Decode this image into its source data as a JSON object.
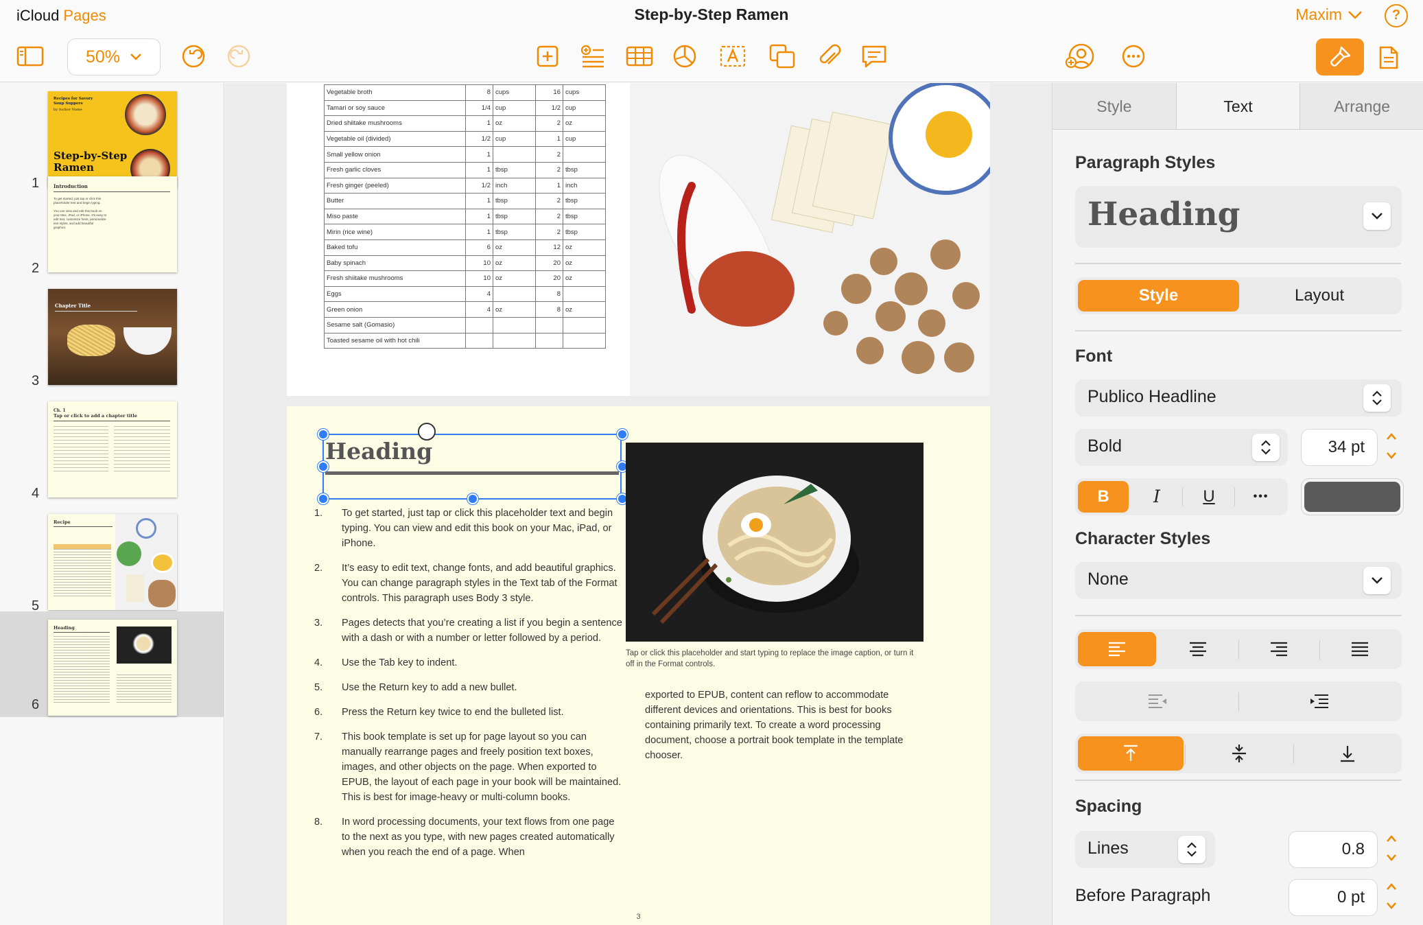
{
  "app": {
    "brand_a": "iCloud",
    "brand_b": "Pages"
  },
  "document": {
    "title": "Step-by-Step Ramen"
  },
  "user": {
    "name": "Maxim"
  },
  "toolbar": {
    "zoom": "50%",
    "icons": [
      "sidebar-icon",
      "undo-icon",
      "redo-icon",
      "add-page-icon",
      "insert-text-icon",
      "table-icon",
      "chart-icon",
      "text-box-icon",
      "shape-icon",
      "attachment-icon",
      "comment-icon",
      "collaborate-icon",
      "more-icon",
      "format-brush-icon",
      "document-icon"
    ],
    "accent": "#f7921e"
  },
  "sidebar": {
    "pages": [
      {
        "num": "1",
        "t1": "Recipes for Savory Soup Suppers",
        "t2": "by Author Name",
        "t3": "Step-by-Step Ramen"
      },
      {
        "num": "2",
        "t1": "Introduction",
        "t2": "To get started, just tap or click this placeholder text and begin typing.",
        "t3": "You can view and edit this book on your Mac, iPad, or iPhone. It's easy to edit text, customize fonts, personalize text styles, and add beautiful graphics."
      },
      {
        "num": "3",
        "t1": "Chapter Title"
      },
      {
        "num": "4",
        "t1": "Ch. 1",
        "t2": "Tap or click to add a chapter title"
      },
      {
        "num": "5",
        "t1": "Recipe"
      },
      {
        "num": "6",
        "t1": "Heading"
      }
    ]
  },
  "ingredients": [
    [
      "Vegetable broth",
      "8",
      "cups",
      "16",
      "cups"
    ],
    [
      "Tamari or soy sauce",
      "1/4",
      "cup",
      "1/2",
      "cup"
    ],
    [
      "Dried shiitake mushrooms",
      "1",
      "oz",
      "2",
      "oz"
    ],
    [
      "Vegetable oil (divided)",
      "1/2",
      "cup",
      "1",
      "cup"
    ],
    [
      "Small yellow onion",
      "1",
      "",
      "2",
      ""
    ],
    [
      "Fresh garlic cloves",
      "1",
      "tbsp",
      "2",
      "tbsp"
    ],
    [
      "Fresh ginger (peeled)",
      "1/2",
      "inch",
      "1",
      "inch"
    ],
    [
      "Butter",
      "1",
      "tbsp",
      "2",
      "tbsp"
    ],
    [
      "Miso paste",
      "1",
      "tbsp",
      "2",
      "tbsp"
    ],
    [
      "Mirin (rice wine)",
      "1",
      "tbsp",
      "2",
      "tbsp"
    ],
    [
      "Baked tofu",
      "6",
      "oz",
      "12",
      "oz"
    ],
    [
      "Baby spinach",
      "10",
      "oz",
      "20",
      "oz"
    ],
    [
      "Fresh shiitake mushrooms",
      "10",
      "oz",
      "20",
      "oz"
    ],
    [
      "Eggs",
      "4",
      "",
      "8",
      ""
    ],
    [
      "Green onion",
      "4",
      "oz",
      "8",
      "oz"
    ],
    [
      "Sesame salt (Gomasio)",
      "",
      "",
      "",
      ""
    ],
    [
      "Toasted sesame oil with hot chili",
      "",
      "",
      "",
      ""
    ]
  ],
  "page": {
    "heading": "Heading",
    "list": [
      {
        "num": "1.",
        "text": "To get started, just tap or click this placeholder text and begin typing. You can view and edit this book on your Mac, iPad, or iPhone."
      },
      {
        "num": "2.",
        "text": "It’s easy to edit text, change fonts, and add beautiful graphics. You can change paragraph styles in the Text tab of the Format controls. This paragraph uses Body 3 style."
      },
      {
        "num": "3.",
        "text": "Pages detects that you’re creating a list if you begin a sentence with a dash or with a number or letter followed by a period."
      },
      {
        "num": "4.",
        "text": "Use the Tab key to indent."
      },
      {
        "num": "5.",
        "text": "Use the Return key to add a new bullet."
      },
      {
        "num": "6.",
        "text": "Press the Return key twice to end the bulleted list."
      },
      {
        "num": "7.",
        "text": "This book template is set up for page layout so you can manually rearrange pages and freely position text boxes, images, and other objects on the page. When exported to EPUB, the layout of each page in your book will be maintained. This is best for image-heavy or multi-column books."
      },
      {
        "num": "8.",
        "text": "In word processing documents, your text flows from one page to the next as you type, with new pages created automatically when you reach the end of a page. When"
      }
    ],
    "caption": "Tap or click this placeholder and start typing to replace the image caption, or turn it off in the Format controls.",
    "col2": "exported to EPUB, content can reflow to accommodate different devices and orientations. This is best for books containing primarily text. To create a word processing document, choose a portrait book template in the template chooser.",
    "page_number": "3"
  },
  "inspector": {
    "tabs": [
      "Style",
      "Text",
      "Arrange"
    ],
    "active_tab": "Text",
    "paragraph_styles_title": "Paragraph Styles",
    "paragraph_style_value": "Heading",
    "seg_style": "Style",
    "seg_layout": "Layout",
    "font_title": "Font",
    "font_name": "Publico Headline",
    "font_weight": "Bold",
    "font_size": "34 pt",
    "bold": "B",
    "italic": "I",
    "underline": "U",
    "more": "•••",
    "text_color": "#5a5a5a",
    "character_styles_title": "Character Styles",
    "character_style_value": "None",
    "spacing_title": "Spacing",
    "spacing_mode": "Lines",
    "spacing_value": "0.8",
    "before_paragraph_label": "Before Paragraph",
    "before_paragraph_value": "0 pt"
  }
}
